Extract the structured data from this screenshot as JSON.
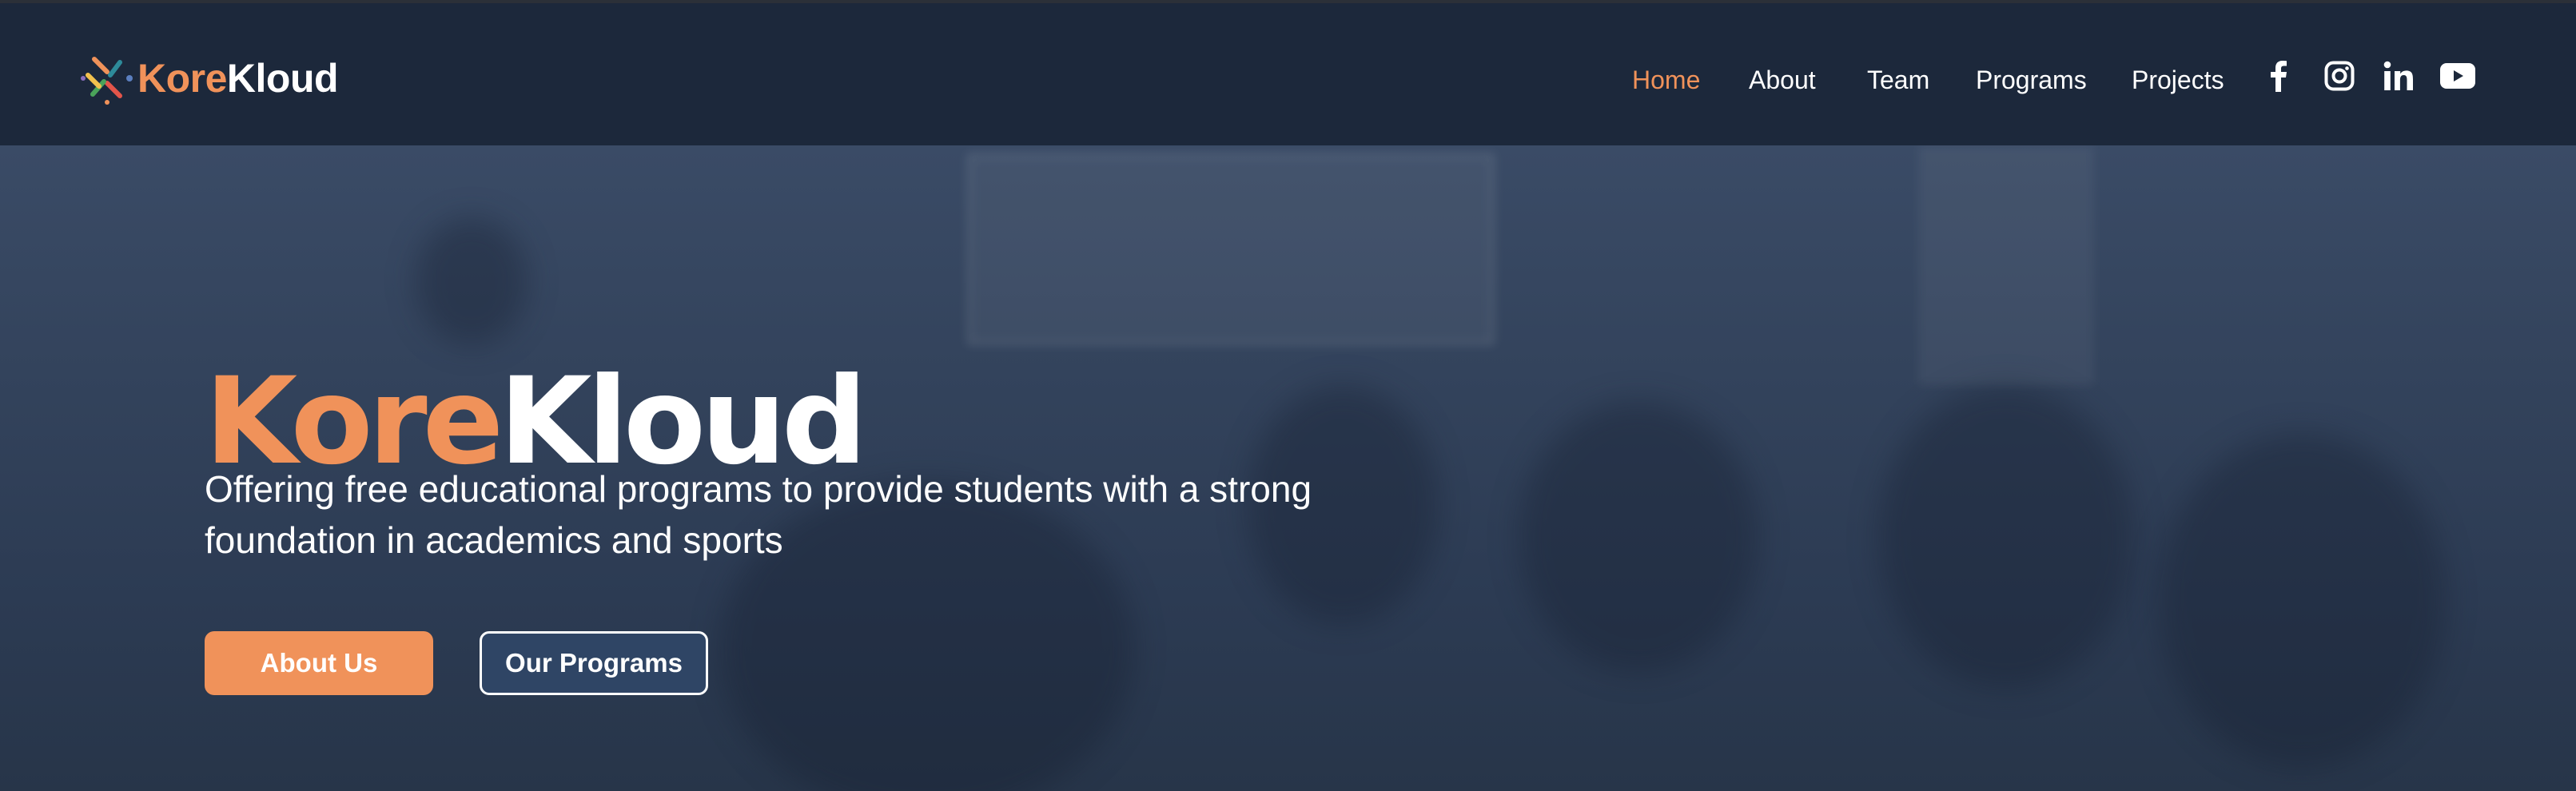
{
  "brand": {
    "name_part1": "Kore",
    "name_part2": "Kloud",
    "accent_color": "#f0925a",
    "nav_bg": "#1c283b"
  },
  "nav": {
    "links": [
      {
        "label": "Home",
        "active": true
      },
      {
        "label": "About",
        "active": false
      },
      {
        "label": "Team",
        "active": false
      },
      {
        "label": "Programs",
        "active": false
      },
      {
        "label": "Projects",
        "active": false
      }
    ],
    "social": [
      "facebook-icon",
      "instagram-icon",
      "linkedin-icon",
      "youtube-icon"
    ]
  },
  "hero": {
    "title_part1": "Kore",
    "title_part2": "Kloud",
    "subtitle_line1": "Offering free educational programs to provide students with a strong",
    "subtitle_line2": "foundation in academics and sports",
    "primary_button": "About Us",
    "secondary_button": "Our Programs"
  }
}
